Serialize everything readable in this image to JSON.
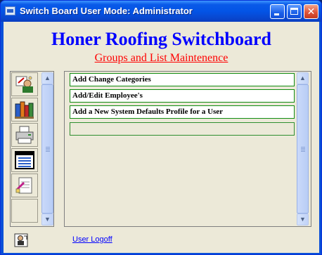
{
  "window": {
    "title": "Switch Board User Mode: Administrator"
  },
  "titlebar_buttons": {
    "minimize": "minimize",
    "maximize": "maximize",
    "close": "close"
  },
  "header": {
    "title": "Honer Roofing Switchboard",
    "subtitle": "Groups and List Maintenence"
  },
  "left_icons": [
    {
      "icon": "admin-user-icon"
    },
    {
      "icon": "groups-books-icon"
    },
    {
      "icon": "printer-icon"
    },
    {
      "icon": "table-form-icon"
    },
    {
      "icon": "report-edit-icon"
    }
  ],
  "menu_items": [
    {
      "label": "Add Change Categories"
    },
    {
      "label": "Add/Edit Employee's"
    },
    {
      "label": "Add a New System Defaults Profile for a User"
    },
    {
      "label": ""
    }
  ],
  "footer": {
    "logoff_label": "User Logoff",
    "logoff_icon": "user-logoff-icon"
  },
  "colors": {
    "title_blue": "#0000ff",
    "subtitle_red": "#ff0000",
    "item_border_green": "#118c11"
  }
}
